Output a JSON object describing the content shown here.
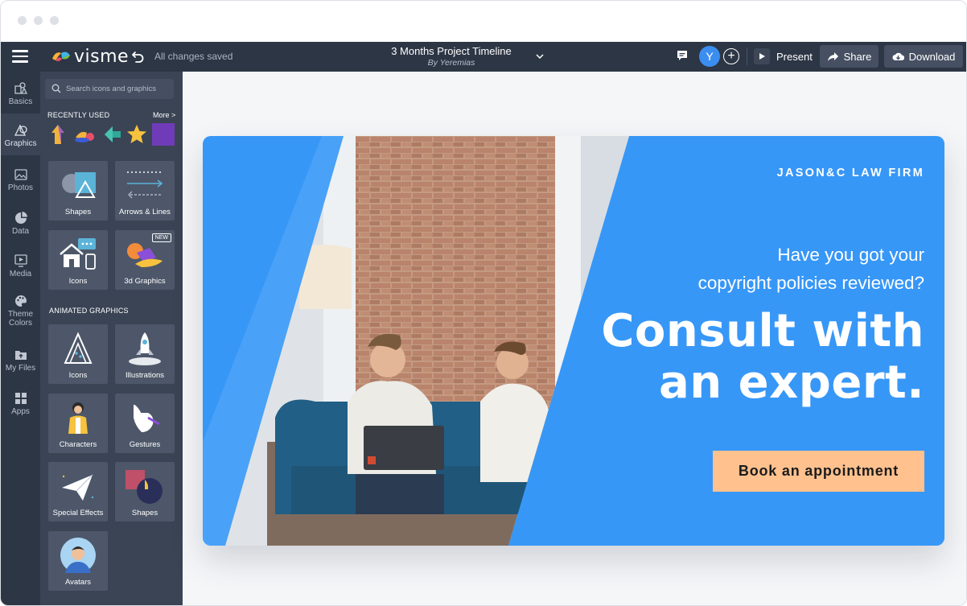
{
  "app": {
    "brand": "visme",
    "save_status": "All changes saved"
  },
  "document": {
    "title": "3 Months Project Timeline",
    "author": "By Yeremias"
  },
  "header": {
    "avatar_initial": "Y",
    "present_label": "Present",
    "share_label": "Share",
    "download_label": "Download",
    "add_collaborator_symbol": "+"
  },
  "rail": {
    "items": [
      {
        "label": "Basics",
        "icon": "basics-icon"
      },
      {
        "label": "Graphics",
        "icon": "graphics-icon",
        "active": true
      },
      {
        "label": "Photos",
        "icon": "photos-icon"
      },
      {
        "label": "Data",
        "icon": "pie-chart-icon"
      },
      {
        "label": "Media",
        "icon": "media-icon"
      },
      {
        "label": "Theme",
        "label2": "Colors",
        "icon": "palette-icon"
      },
      {
        "label": "My Files",
        "icon": "folder-upload-icon"
      },
      {
        "label": "Apps",
        "icon": "apps-grid-icon"
      }
    ]
  },
  "panel": {
    "search_placeholder": "Search icons and graphics",
    "recently_used_label": "RECENTLY USED",
    "more_label": "More >",
    "animated_label": "ANIMATED GRAPHICS",
    "new_badge": "NEW",
    "tiles": [
      {
        "label": "Shapes"
      },
      {
        "label": "Arrows & Lines"
      },
      {
        "label": "Icons"
      },
      {
        "label": "3d Graphics"
      }
    ],
    "animated_tiles": [
      {
        "label": "Icons"
      },
      {
        "label": "Illustrations"
      },
      {
        "label": "Characters"
      },
      {
        "label": "Gestures"
      },
      {
        "label": "Special Effects"
      },
      {
        "label": "Shapes"
      },
      {
        "label": "Avatars"
      }
    ]
  },
  "banner": {
    "firm": "JASON&C LAW FIRM",
    "question_line1": "Have you got your",
    "question_line2": "copyright policies reviewed?",
    "headline_line1": "Consult with",
    "headline_line2": "an expert.",
    "cta_label": "Book an appointment"
  },
  "colors": {
    "topbar": "#2d3645",
    "panel": "#3a4455",
    "banner_blue": "#3797f7",
    "cta": "#ffc18e",
    "avatar": "#3b8ef0"
  }
}
